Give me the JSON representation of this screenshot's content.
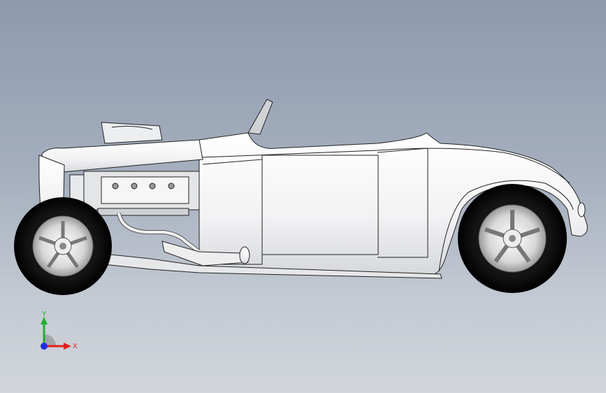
{
  "viewport": {
    "background_top": "#8d9aae",
    "background_bottom": "#d2d6dc",
    "model": "hot-rod-roadster",
    "view": "side-view"
  },
  "triad": {
    "x_label": "X",
    "y_label": "Y",
    "x_color": "#e02020",
    "y_color": "#1fb030",
    "z_color": "#1f2fe0"
  }
}
